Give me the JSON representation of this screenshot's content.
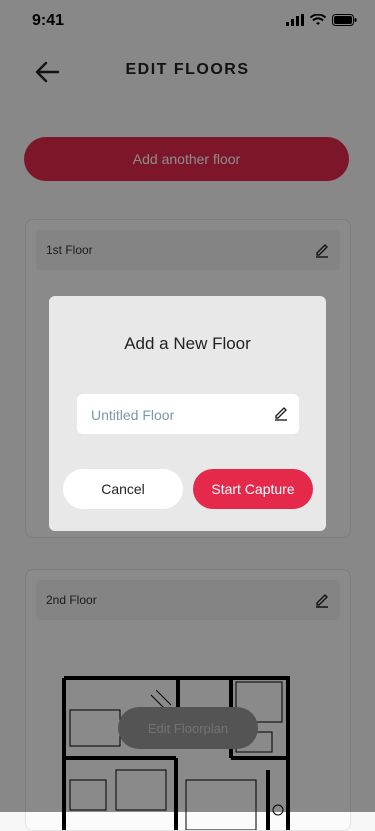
{
  "status_bar": {
    "time": "9:41",
    "icons": [
      "signal-icon",
      "wifi-icon",
      "battery-icon"
    ]
  },
  "header": {
    "title": "EDIT FLOORS",
    "back_icon": "arrow-left-icon"
  },
  "add_floor_button": {
    "label": "Add another floor"
  },
  "floors": [
    {
      "name": "1st Floor",
      "edit_icon": "pencil-icon"
    },
    {
      "name": "2nd Floor",
      "edit_icon": "pencil-icon",
      "action_label": "Edit Floorplan"
    }
  ],
  "modal": {
    "title": "Add a New Floor",
    "input_placeholder": "Untitled Floor",
    "input_icon": "pencil-icon",
    "cancel_label": "Cancel",
    "start_label": "Start Capture"
  },
  "colors": {
    "accent": "#e5294b",
    "overlay": "rgba(0,0,0,0.45)",
    "placeholder": "#7a9aa5"
  }
}
